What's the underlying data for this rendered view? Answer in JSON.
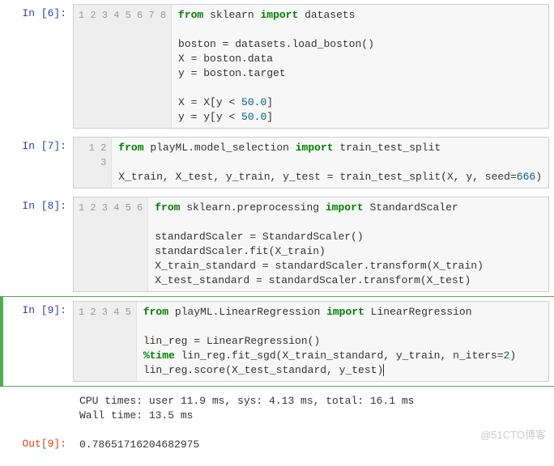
{
  "cells": [
    {
      "prompt_in": "In  [6]:",
      "lines": [
        "1",
        "2",
        "3",
        "4",
        "5",
        "6",
        "7",
        "8"
      ],
      "tokens": [
        [
          {
            "t": "from ",
            "c": "kw"
          },
          {
            "t": "sklearn "
          },
          {
            "t": "import ",
            "c": "kw"
          },
          {
            "t": "datasets"
          }
        ],
        [
          {
            "t": ""
          }
        ],
        [
          {
            "t": "boston = datasets.load_boston()"
          }
        ],
        [
          {
            "t": "X = boston.data"
          }
        ],
        [
          {
            "t": "y = boston.target"
          }
        ],
        [
          {
            "t": ""
          }
        ],
        [
          {
            "t": "X = X[y < "
          },
          {
            "t": "50.0",
            "c": "num"
          },
          {
            "t": "]"
          }
        ],
        [
          {
            "t": "y = y[y < "
          },
          {
            "t": "50.0",
            "c": "num"
          },
          {
            "t": "]"
          }
        ]
      ]
    },
    {
      "prompt_in": "In  [7]:",
      "lines": [
        "1",
        "2",
        "3"
      ],
      "tokens": [
        [
          {
            "t": "from ",
            "c": "kw"
          },
          {
            "t": "playML.model_selection "
          },
          {
            "t": "import ",
            "c": "kw"
          },
          {
            "t": "train_test_split"
          }
        ],
        [
          {
            "t": ""
          }
        ],
        [
          {
            "t": "X_train, X_test, y_train, y_test = train_test_split(X, y, seed="
          },
          {
            "t": "666",
            "c": "num"
          },
          {
            "t": ")"
          }
        ]
      ]
    },
    {
      "prompt_in": "In  [8]:",
      "lines": [
        "1",
        "2",
        "3",
        "4",
        "5",
        "6"
      ],
      "tokens": [
        [
          {
            "t": "from ",
            "c": "kw"
          },
          {
            "t": "sklearn.preprocessing "
          },
          {
            "t": "import ",
            "c": "kw"
          },
          {
            "t": "StandardScaler"
          }
        ],
        [
          {
            "t": ""
          }
        ],
        [
          {
            "t": "standardScaler = StandardScaler()"
          }
        ],
        [
          {
            "t": "standardScaler.fit(X_train)"
          }
        ],
        [
          {
            "t": "X_train_standard = standardScaler.transform(X_train)"
          }
        ],
        [
          {
            "t": "X_test_standard = standardScaler.transform(X_test)"
          }
        ]
      ]
    },
    {
      "prompt_in": "In  [9]:",
      "lines": [
        "1",
        "2",
        "3",
        "4",
        "5"
      ],
      "tokens": [
        [
          {
            "t": "from ",
            "c": "kw"
          },
          {
            "t": "playML.LinearRegression "
          },
          {
            "t": "import ",
            "c": "kw"
          },
          {
            "t": "LinearRegression"
          }
        ],
        [
          {
            "t": ""
          }
        ],
        [
          {
            "t": "lin_reg = LinearRegression()"
          }
        ],
        [
          {
            "t": "%time",
            "c": "magic"
          },
          {
            "t": " lin_reg.fit_sgd(X_train_standard, y_train, n_iters="
          },
          {
            "t": "2",
            "c": "num"
          },
          {
            "t": ")"
          }
        ],
        [
          {
            "t": "lin_reg.score(X_test_standard, y_test)"
          },
          {
            "t": "",
            "cursor": true
          }
        ]
      ],
      "output_stream": "CPU times: user 11.9 ms, sys: 4.13 ms, total: 16.1 ms\nWall time: 13.5 ms",
      "prompt_out": "Out[9]:",
      "output_result": "0.78651716204682975",
      "highlighted": true
    }
  ],
  "watermark": "@51CTO博客"
}
